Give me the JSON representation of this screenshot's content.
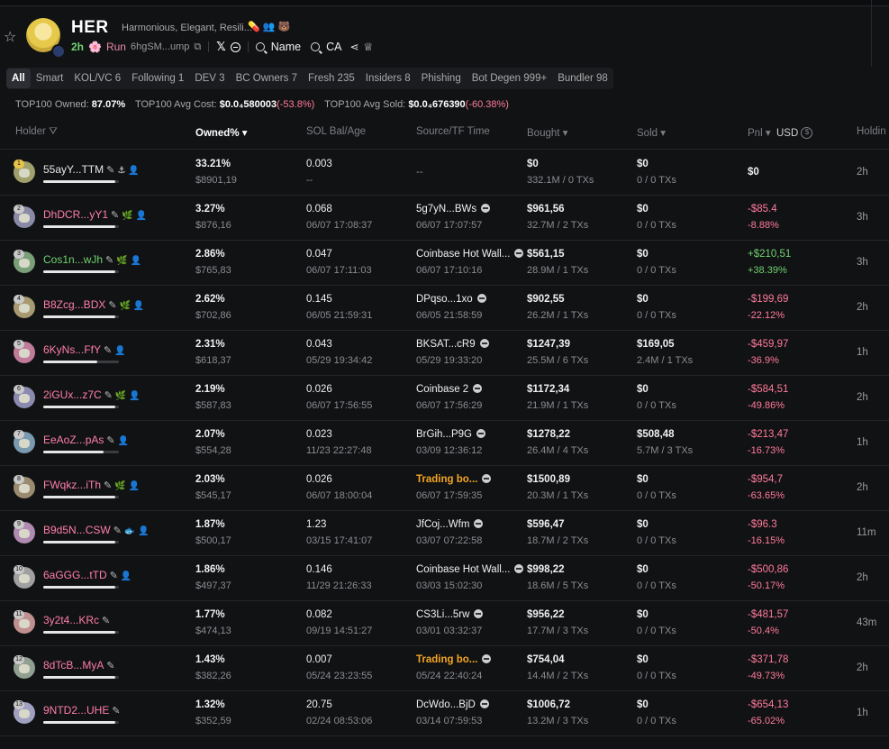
{
  "token": {
    "name": "HER",
    "description": "Harmonious, Elegant, Resili...",
    "age": "2h",
    "run_label": "Run",
    "address": "6hgSM...ump",
    "name_search": "Name",
    "ca_search": "CA"
  },
  "tabs": [
    {
      "label": "All",
      "active": true
    },
    {
      "label": "Smart"
    },
    {
      "label": "KOL/VC 6"
    },
    {
      "label": "Following 1"
    },
    {
      "label": "DEV 3"
    },
    {
      "label": "BC Owners 7"
    },
    {
      "label": "Fresh 235"
    },
    {
      "label": "Insiders 8"
    },
    {
      "label": "Phishing"
    },
    {
      "label": "Bot Degen 999+"
    },
    {
      "label": "Bundler 98"
    }
  ],
  "stats": {
    "owned_label": "TOP100 Owned:",
    "owned_value": "87.07%",
    "avg_cost_label": "TOP100 Avg Cost:",
    "avg_cost_value": "$0.0₄580003",
    "avg_cost_change": "(-53.8%)",
    "avg_sold_label": "TOP100 Avg Sold:",
    "avg_sold_value": "$0.0₄676390",
    "avg_sold_change": "(-60.38%)"
  },
  "columns": {
    "holder": "Holder",
    "owned": "Owned% ▾",
    "sol_bal": "SOL Bal/Age",
    "source": "Source/TF Time",
    "bought": "Bought ▾",
    "sold": "Sold ▾",
    "pnl": "Pnl ▾",
    "usd": "USD",
    "holding": "Holdin"
  },
  "rows": [
    {
      "rank": "1",
      "name": "55ayY...TTM",
      "color": "white",
      "tags": "⚓ 👤",
      "bar": 0.95,
      "owned": "33.21%",
      "owned_usd": "$8901,19",
      "sol": "0.003",
      "sol_age": "--",
      "source": "--",
      "source_time": "",
      "bought": "$0",
      "bought_sub": "332.1M / 0 TXs",
      "sold": "$0",
      "sold_sub": "0 / 0 TXs",
      "pnl": "$0",
      "pnl_pct": "",
      "pnl_class": "",
      "holding": "2h"
    },
    {
      "rank": "2",
      "name": "DhDCR...yY1",
      "color": "pink",
      "tags": "🌿 👤",
      "bar": 0.95,
      "owned": "3.27%",
      "owned_usd": "$876,16",
      "sol": "0.068",
      "sol_age": "06/07 17:08:37",
      "source": "5g7yN...BWs",
      "source_time": "06/07 17:07:57",
      "bought": "$961,56",
      "bought_sub": "32.7M / 2 TXs",
      "sold": "$0",
      "sold_sub": "0 / 0 TXs",
      "pnl": "-$85.4",
      "pnl_pct": "-8.88%",
      "pnl_class": "neg",
      "holding": "3h"
    },
    {
      "rank": "3",
      "name": "Cos1n...wJh",
      "color": "green",
      "tags": "🌿 👤",
      "bar": 0.95,
      "owned": "2.86%",
      "owned_usd": "$765,83",
      "sol": "0.047",
      "sol_age": "06/07 17:11:03",
      "source": "Coinbase Hot Wall...",
      "source_time": "06/07 17:10:16",
      "bought": "$561,15",
      "bought_sub": "28.9M / 1 TXs",
      "sold": "$0",
      "sold_sub": "0 / 0 TXs",
      "pnl": "+$210,51",
      "pnl_pct": "+38.39%",
      "pnl_class": "pos",
      "holding": "3h"
    },
    {
      "rank": "4",
      "name": "B8Zcg...BDX",
      "color": "pink",
      "tags": "🌿 👤",
      "bar": 0.95,
      "owned": "2.62%",
      "owned_usd": "$702,86",
      "sol": "0.145",
      "sol_age": "06/05 21:59:31",
      "source": "DPqso...1xo",
      "source_time": "06/05 21:58:59",
      "bought": "$902,55",
      "bought_sub": "26.2M / 1 TXs",
      "sold": "$0",
      "sold_sub": "0 / 0 TXs",
      "pnl": "-$199,69",
      "pnl_pct": "-22.12%",
      "pnl_class": "neg",
      "holding": "2h"
    },
    {
      "rank": "5",
      "name": "6KyNs...FfY",
      "color": "pink",
      "tags": "👤",
      "bar": 0.72,
      "owned": "2.31%",
      "owned_usd": "$618,37",
      "sol": "0.043",
      "sol_age": "05/29 19:34:42",
      "source": "BKSAT...cR9",
      "source_time": "05/29 19:33:20",
      "bought": "$1247,39",
      "bought_sub": "25.5M / 6 TXs",
      "sold": "$169,05",
      "sold_sub": "2.4M / 1 TXs",
      "pnl": "-$459,97",
      "pnl_pct": "-36.9%",
      "pnl_class": "neg",
      "holding": "1h"
    },
    {
      "rank": "6",
      "name": "2iGUx...z7C",
      "color": "pink",
      "tags": "🌿 👤",
      "bar": 0.95,
      "owned": "2.19%",
      "owned_usd": "$587,83",
      "sol": "0.026",
      "sol_age": "06/07 17:56:55",
      "source": "Coinbase 2",
      "source_time": "06/07 17:56:29",
      "bought": "$1172,34",
      "bought_sub": "21.9M / 1 TXs",
      "sold": "$0",
      "sold_sub": "0 / 0 TXs",
      "pnl": "-$584,51",
      "pnl_pct": "-49.86%",
      "pnl_class": "neg",
      "holding": "2h"
    },
    {
      "rank": "7",
      "name": "EeAoZ...pAs",
      "color": "pink",
      "tags": "👤",
      "bar": 0.8,
      "owned": "2.07%",
      "owned_usd": "$554,28",
      "sol": "0.023",
      "sol_age": "11/23 22:27:48",
      "source": "BrGih...P9G",
      "source_time": "03/09 12:36:12",
      "bought": "$1278,22",
      "bought_sub": "26.4M / 4 TXs",
      "sold": "$508,48",
      "sold_sub": "5.7M / 3 TXs",
      "pnl": "-$213,47",
      "pnl_pct": "-16.73%",
      "pnl_class": "neg",
      "holding": "1h"
    },
    {
      "rank": "8",
      "name": "FWqkz...iTh",
      "color": "pink",
      "tags": "🌿 👤",
      "bar": 0.95,
      "owned": "2.03%",
      "owned_usd": "$545,17",
      "sol": "0.026",
      "sol_age": "06/07 18:00:04",
      "source": "Trading bo...",
      "source_time": "06/07 17:59:35",
      "source_orange": true,
      "bought": "$1500,89",
      "bought_sub": "20.3M / 1 TXs",
      "sold": "$0",
      "sold_sub": "0 / 0 TXs",
      "pnl": "-$954,7",
      "pnl_pct": "-63.65%",
      "pnl_class": "neg",
      "holding": "2h"
    },
    {
      "rank": "9",
      "name": "B9d5N...CSW",
      "color": "pink",
      "tags": "🐟 👤",
      "bar": 0.95,
      "owned": "1.87%",
      "owned_usd": "$500,17",
      "sol": "1.23",
      "sol_age": "03/15 17:41:07",
      "source": "JfCoj...Wfm",
      "source_time": "03/07 07:22:58",
      "bought": "$596,47",
      "bought_sub": "18.7M / 2 TXs",
      "sold": "$0",
      "sold_sub": "0 / 0 TXs",
      "pnl": "-$96.3",
      "pnl_pct": "-16.15%",
      "pnl_class": "neg",
      "holding": "11m"
    },
    {
      "rank": "10",
      "name": "6aGGG...tTD",
      "color": "pink",
      "tags": "👤",
      "bar": 0.95,
      "owned": "1.86%",
      "owned_usd": "$497,37",
      "sol": "0.146",
      "sol_age": "11/29 21:26:33",
      "source": "Coinbase Hot Wall...",
      "source_time": "03/03 15:02:30",
      "bought": "$998,22",
      "bought_sub": "18.6M / 5 TXs",
      "sold": "$0",
      "sold_sub": "0 / 0 TXs",
      "pnl": "-$500,86",
      "pnl_pct": "-50.17%",
      "pnl_class": "neg",
      "holding": "2h"
    },
    {
      "rank": "11",
      "name": "3y2t4...KRc",
      "color": "pink",
      "tags": "",
      "bar": 0.95,
      "owned": "1.77%",
      "owned_usd": "$474,13",
      "sol": "0.082",
      "sol_age": "09/19 14:51:27",
      "source": "CS3Li...5rw",
      "source_time": "03/01 03:32:37",
      "bought": "$956,22",
      "bought_sub": "17.7M / 3 TXs",
      "sold": "$0",
      "sold_sub": "0 / 0 TXs",
      "pnl": "-$481,57",
      "pnl_pct": "-50.4%",
      "pnl_class": "neg",
      "holding": "43m"
    },
    {
      "rank": "12",
      "name": "8dTcB...MyA",
      "color": "pink",
      "tags": "",
      "bar": 0.95,
      "owned": "1.43%",
      "owned_usd": "$382,26",
      "sol": "0.007",
      "sol_age": "05/24 23:23:55",
      "source": "Trading bo...",
      "source_time": "05/24 22:40:24",
      "source_orange": true,
      "bought": "$754,04",
      "bought_sub": "14.4M / 2 TXs",
      "sold": "$0",
      "sold_sub": "0 / 0 TXs",
      "pnl": "-$371,78",
      "pnl_pct": "-49.73%",
      "pnl_class": "neg",
      "holding": "2h"
    },
    {
      "rank": "13",
      "name": "9NTD2...UHE",
      "color": "pink",
      "tags": "",
      "bar": 0.95,
      "owned": "1.32%",
      "owned_usd": "$352,59",
      "sol": "20.75",
      "sol_age": "02/24 08:53:06",
      "source": "DcWdo...BjD",
      "source_time": "03/14 07:59:53",
      "bought": "$1006,72",
      "bought_sub": "13.2M / 3 TXs",
      "sold": "$0",
      "sold_sub": "0 / 0 TXs",
      "pnl": "-$654,13",
      "pnl_pct": "-65.02%",
      "pnl_class": "neg",
      "holding": "1h"
    }
  ]
}
